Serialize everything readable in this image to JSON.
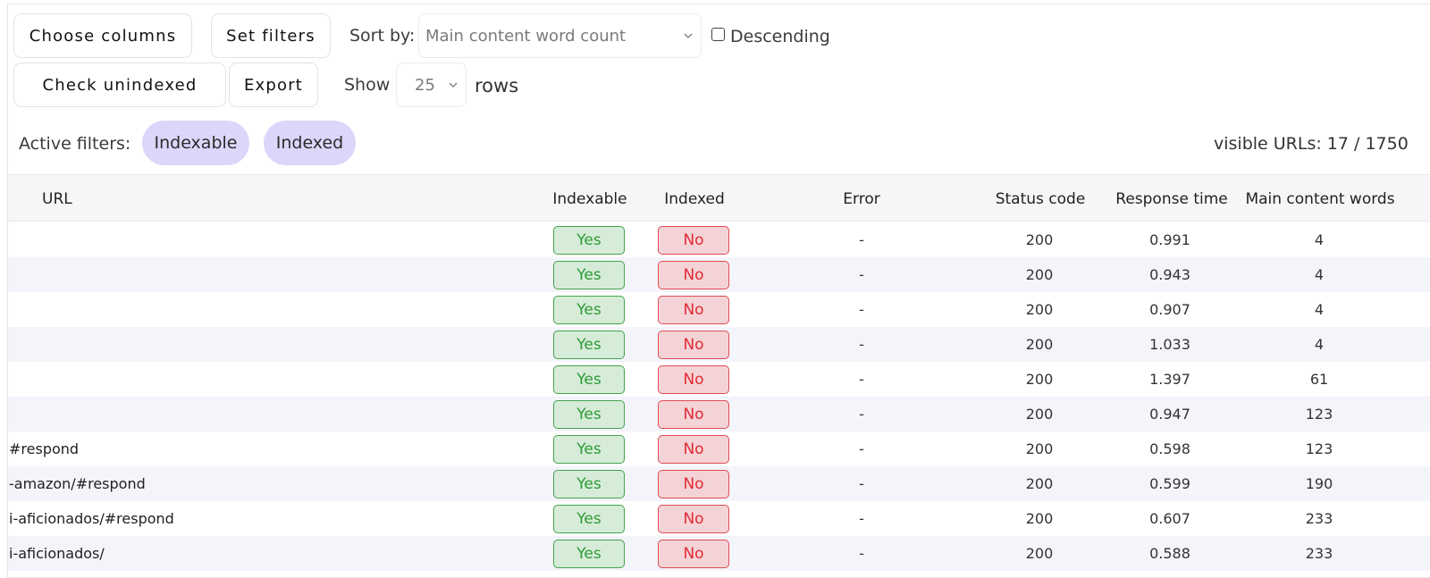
{
  "toolbar": {
    "choose_columns_label": "Choose columns",
    "set_filters_label": "Set filters",
    "sort_by_label": "Sort by:",
    "sort_by_value": "Main content word count",
    "descending_label": "Descending",
    "descending_checked": false,
    "check_unindexed_label": "Check unindexed",
    "export_label": "Export",
    "show_label": "Show",
    "rows_value": "25",
    "rows_label": "rows"
  },
  "filters": {
    "label": "Active filters:",
    "chips": [
      "Indexable",
      "Indexed"
    ],
    "visible_count": "visible URLs: 17 / 1750"
  },
  "table": {
    "columns": [
      "URL",
      "Indexable",
      "Indexed",
      "Error",
      "Status code",
      "Response time",
      "Main content words"
    ],
    "rows": [
      {
        "url": "",
        "indexable": "Yes",
        "indexed": "No",
        "error": "-",
        "status": "200",
        "time": "0.991",
        "words": "4"
      },
      {
        "url": "",
        "indexable": "Yes",
        "indexed": "No",
        "error": "-",
        "status": "200",
        "time": "0.943",
        "words": "4"
      },
      {
        "url": "",
        "indexable": "Yes",
        "indexed": "No",
        "error": "-",
        "status": "200",
        "time": "0.907",
        "words": "4"
      },
      {
        "url": "",
        "indexable": "Yes",
        "indexed": "No",
        "error": "-",
        "status": "200",
        "time": "1.033",
        "words": "4"
      },
      {
        "url": "",
        "indexable": "Yes",
        "indexed": "No",
        "error": "-",
        "status": "200",
        "time": "1.397",
        "words": "61"
      },
      {
        "url": "",
        "indexable": "Yes",
        "indexed": "No",
        "error": "-",
        "status": "200",
        "time": "0.947",
        "words": "123"
      },
      {
        "url": "#respond",
        "indexable": "Yes",
        "indexed": "No",
        "error": "-",
        "status": "200",
        "time": "0.598",
        "words": "123"
      },
      {
        "url": "-amazon/#respond",
        "indexable": "Yes",
        "indexed": "No",
        "error": "-",
        "status": "200",
        "time": "0.599",
        "words": "190"
      },
      {
        "url": "i-aficionados/#respond",
        "indexable": "Yes",
        "indexed": "No",
        "error": "-",
        "status": "200",
        "time": "0.607",
        "words": "233"
      },
      {
        "url": "i-aficionados/",
        "indexable": "Yes",
        "indexed": "No",
        "error": "-",
        "status": "200",
        "time": "0.588",
        "words": "233"
      }
    ]
  },
  "colors": {
    "chip_bg": "#dcd6fb",
    "yes_bg": "#d6ecd8",
    "yes_border": "#43a34c",
    "no_bg": "#f4d3d6",
    "no_border": "#e04b55",
    "alt_row_bg": "#f4f4fb"
  }
}
